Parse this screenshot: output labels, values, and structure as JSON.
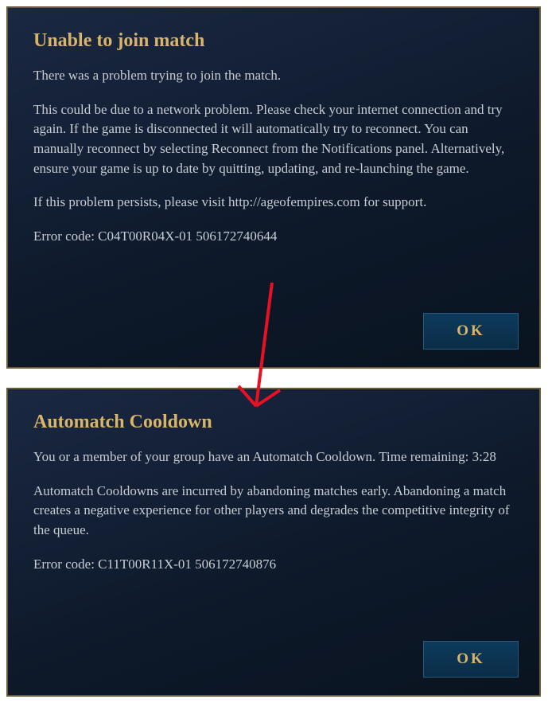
{
  "dialog1": {
    "title": "Unable to join match",
    "para1": "There was a problem trying to join the match.",
    "para2": "This could be due to a network problem. Please check your internet connection and try again. If the game is disconnected it will automatically try to reconnect. You can manually reconnect by selecting Reconnect from the Notifications panel. Alternatively, ensure your game is up to date by quitting, updating, and re-launching the game.",
    "para3": "If this problem persists, please visit http://ageofempires.com for support.",
    "error_code": "Error code: C04T00R04X-01 506172740644",
    "ok_label": "OK"
  },
  "dialog2": {
    "title": "Automatch Cooldown",
    "para1": "You or a member of your group have an Automatch Cooldown. Time remaining: 3:28",
    "para2": "Automatch Cooldowns are incurred by abandoning matches early. Abandoning a match creates a negative experience for other players and degrades the competitive integrity of the queue.",
    "error_code": "Error code: C11T00R11X-01 506172740876",
    "ok_label": "OK"
  }
}
